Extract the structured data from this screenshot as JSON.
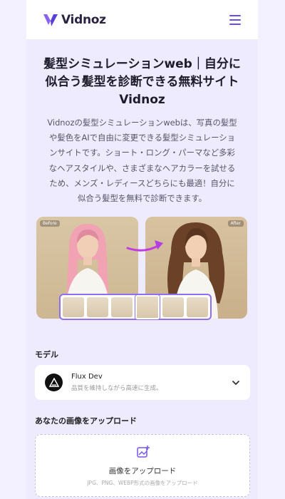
{
  "header": {
    "logo_text": "Vidnoz",
    "brand_color": "#6d4ce8",
    "menu_icon": "hamburger-menu-icon"
  },
  "hero": {
    "title_lines": [
      "髪型シミュレーションweb｜自分に",
      "似合う髪型を診断できる無料サイト",
      "Vidnoz"
    ],
    "intro_lines": [
      "Vidnozの髪型シミュレーションwebは、写真の髪型",
      "や髪色をAIで自由に変更できる髪型シミュレーショ",
      "ンサイトです。ショート・ロング・パーマなど多彩",
      "なヘアスタイルや、さまざまなヘアカラーを試せる",
      "ため、メンズ・レディースどちらにも最適！自分に",
      "似合う髪型を無料で診断できます。"
    ]
  },
  "comparison": {
    "before_label": "Before",
    "after_label": "After"
  },
  "model_section": {
    "label": "モデル",
    "selected_name": "Flux Dev",
    "selected_desc": "品質を維持しながら高速に生成。"
  },
  "upload_section": {
    "label": "あなたの画像をアップロード",
    "button_title": "画像をアップロード",
    "formats": "JPG、PNG、WEBP形式の画像をアップロード"
  }
}
